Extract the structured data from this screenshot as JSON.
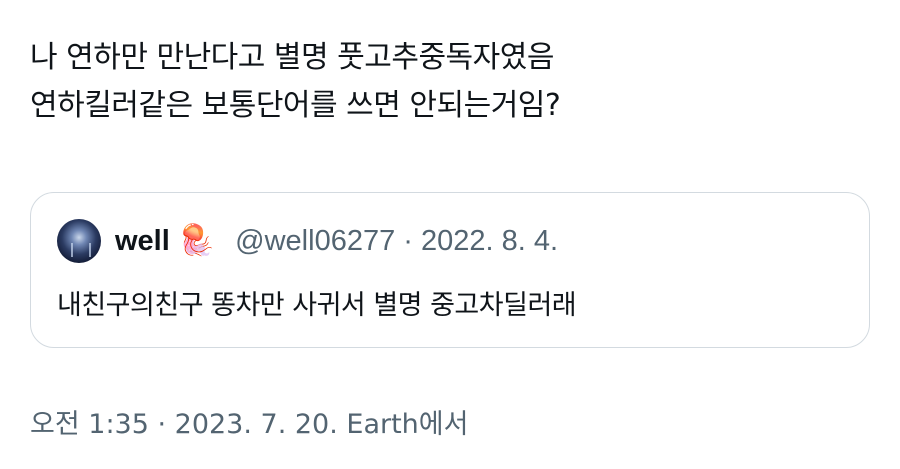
{
  "tweet": {
    "lines": [
      "나 연하만 만난다고 별명 풋고추중독자였음",
      "연하킬러같은 보통단어를 쓰면 안되는거임?"
    ],
    "meta": "오전 1:35 · 2023. 7. 20. Earth에서"
  },
  "quote": {
    "display_name": "well",
    "name_emoji": "🪼",
    "handle_date": "@well06277 · 2022. 8. 4.",
    "text": "내친구의친구 똥차만 사귀서 별명 중고차딜러래",
    "avatar_icon": "jellyfish-avatar"
  },
  "colors": {
    "text": "#0f1419",
    "secondary": "#536471",
    "border": "#d3dae0"
  }
}
